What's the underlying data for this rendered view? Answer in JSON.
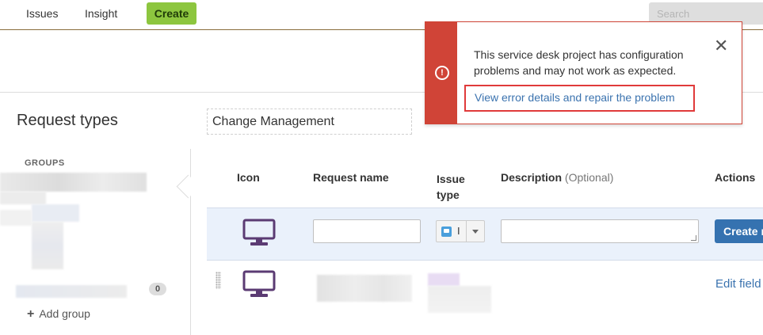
{
  "nav": {
    "issues_label": "Issues",
    "insight_label": "Insight",
    "create_label": "Create",
    "search_placeholder": "Search"
  },
  "page": {
    "title": "Request types",
    "project_name": "Change Management"
  },
  "sidebar": {
    "groups_heading": "GROUPS",
    "group_count": "0",
    "add_group_label": "Add group"
  },
  "table": {
    "headers": {
      "icon": "Icon",
      "request_name": "Request name",
      "issue_type_line1": "Issue",
      "issue_type_line2": "type",
      "description": "Description",
      "description_optional": "(Optional)",
      "actions": "Actions"
    },
    "create_row": {
      "issue_type_selected": "I",
      "create_button_label": "Create r"
    },
    "rows": [
      {
        "action_label": "Edit field"
      }
    ]
  },
  "flag": {
    "message": "This service desk project has configuration problems and may not work as expected.",
    "link_text": "View error details and repair the problem",
    "close_glyph": "✕",
    "icon_glyph": "!"
  },
  "colors": {
    "create_green": "#8dc63f",
    "error_red": "#d04437",
    "link_blue": "#3b73af",
    "primary_button": "#3572b0",
    "monitor_icon": "#5b3b73"
  }
}
